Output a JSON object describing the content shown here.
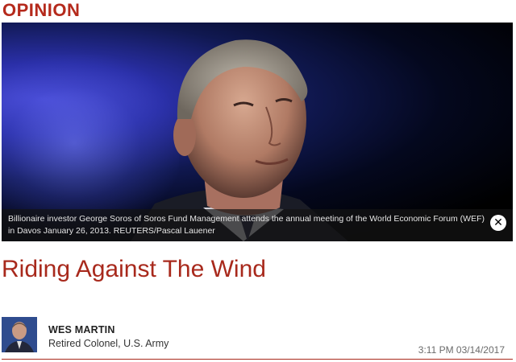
{
  "section": {
    "label": "OPINION"
  },
  "photo": {
    "caption": "Billionaire investor George Soros of Soros Fund Management attends the annual meeting of the World Economic Forum (WEF) in Davos January 26, 2013. REUTERS/Pascal Lauener",
    "close_icon": "close-icon"
  },
  "article": {
    "headline": "Riding Against The Wind"
  },
  "author": {
    "name": "WES MARTIN",
    "title": "Retired Colonel, U.S. Army",
    "timestamp": "3:11 PM 03/14/2017"
  },
  "colors": {
    "accent": "#a8291c",
    "section": "#b52a1c"
  }
}
